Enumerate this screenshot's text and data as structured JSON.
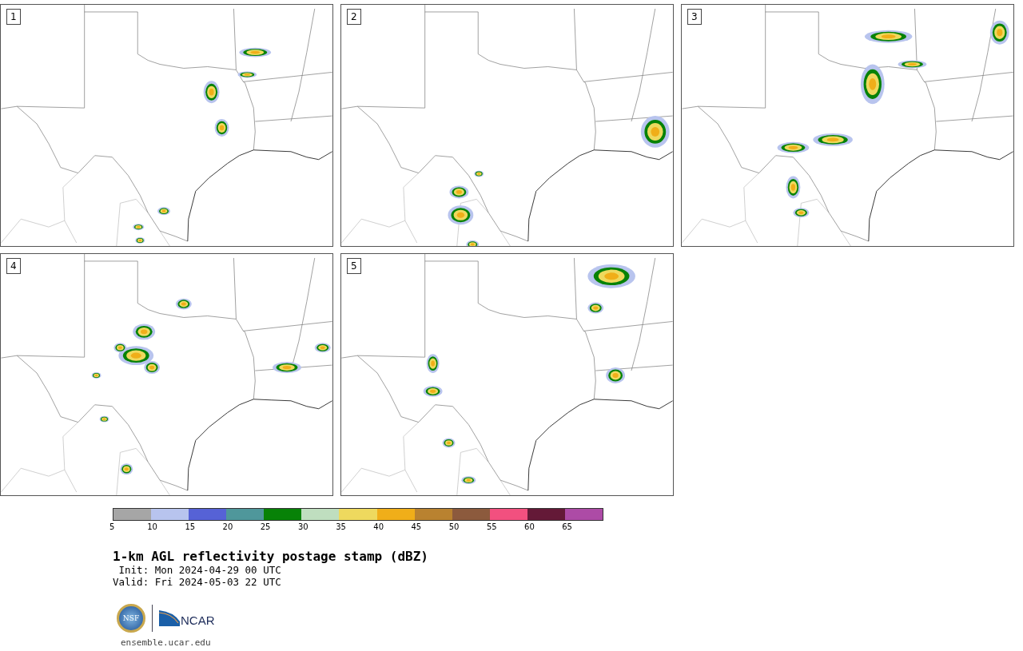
{
  "panels": [
    {
      "label": "1"
    },
    {
      "label": "2"
    },
    {
      "label": "3"
    },
    {
      "label": "4"
    },
    {
      "label": "5"
    }
  ],
  "colorbar": {
    "bins": [
      {
        "color": "#a6a6a6"
      },
      {
        "color": "#b8c4ee"
      },
      {
        "color": "#5662d6"
      },
      {
        "color": "#4f979b"
      },
      {
        "color": "#078207"
      },
      {
        "color": "#bfdebf"
      },
      {
        "color": "#eed95e"
      },
      {
        "color": "#f0ae19"
      },
      {
        "color": "#b98230"
      },
      {
        "color": "#8c5a3d"
      },
      {
        "color": "#f2507f"
      },
      {
        "color": "#641937"
      },
      {
        "color": "#ad4ba6"
      }
    ],
    "ticks": [
      "5",
      "10",
      "15",
      "20",
      "25",
      "30",
      "35",
      "40",
      "45",
      "50",
      "55",
      "60",
      "65"
    ]
  },
  "title": "1-km AGL reflectivity postage stamp (dBZ)",
  "init": " Init: Mon 2024-04-29 00 UTC",
  "valid": "Valid: Fri 2024-05-03 22 UTC",
  "logos": {
    "nsf": "NSF",
    "ncar": "NCAR"
  },
  "url": "ensemble.ucar.edu"
}
